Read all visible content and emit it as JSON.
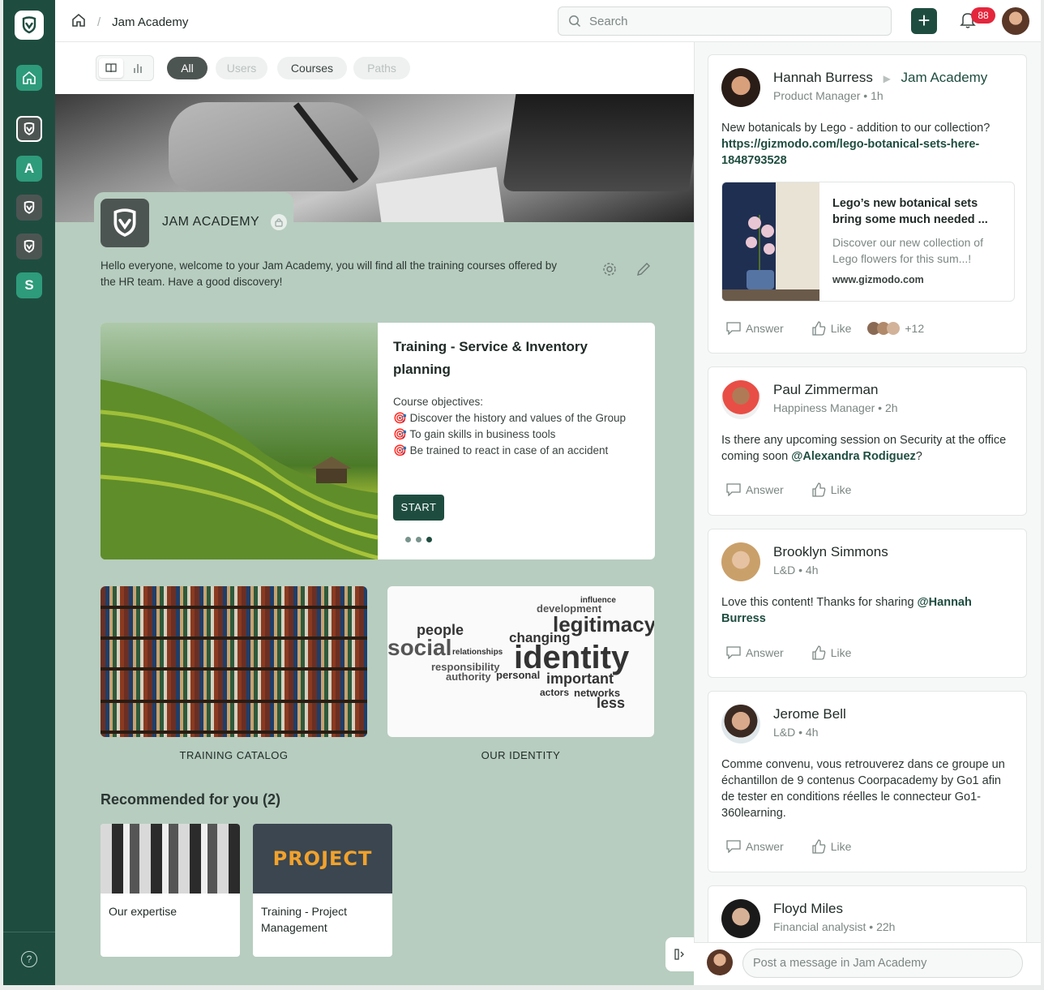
{
  "colors": {
    "brand": "#1e4d40",
    "page_bg": "#b7cdbf",
    "badge": "#e4263c"
  },
  "rail": {
    "items": [
      {
        "icon": "home-icon"
      },
      {
        "icon": "jam-logo-icon"
      },
      {
        "letter": "A"
      },
      {
        "icon": "jam-logo-icon"
      },
      {
        "icon": "jam-logo-icon"
      },
      {
        "letter": "S"
      }
    ],
    "help_label": "?"
  },
  "topbar": {
    "crumb": "Jam Academy",
    "search_placeholder": "Search",
    "plus_label": "+",
    "notifications_count": "88"
  },
  "filters": {
    "all": "All",
    "users": "Users",
    "courses": "Courses",
    "paths": "Paths"
  },
  "space": {
    "name": "JAM ACADEMY",
    "description": "Hello everyone, welcome to your Jam Academy, you will find all the training courses offered by the HR team. Have a good discovery!"
  },
  "featured": {
    "title": "Training - Service & Inventory planning",
    "objectives_title": "Course objectives:",
    "objectives": [
      "Discover the history and values of the Group",
      "To gain skills in business tools",
      "Be trained to react in case of an accident"
    ],
    "start": "START"
  },
  "tiles": {
    "catalog": "TRAINING CATALOG",
    "identity": "OUR IDENTITY"
  },
  "cloud_words": [
    "legitimacy",
    "identity",
    "social",
    "people",
    "changing",
    "development",
    "important",
    "networks",
    "less",
    "actors",
    "authority",
    "personal",
    "responsibility",
    "relationships",
    "influence"
  ],
  "recommended": {
    "title": "Recommended for you (2)",
    "items": [
      "Our expertise",
      "Training - Project Management"
    ],
    "project_word": "PROJECT"
  },
  "feed": {
    "posts": [
      {
        "name": "Hannah Burress",
        "target": "Jam Academy",
        "role": "Product Manager • 1h",
        "text": "New botanicals by Lego - addition to our collection? ",
        "link": "https://gizmodo.com/lego-botanical-sets-here-1848793528",
        "preview_title": "Lego’s new botanical sets bring some much needed ...",
        "preview_desc": "Discover our new collection of Lego flowers for this sum...!",
        "preview_url": "www.gizmodo.com",
        "answer": "Answer",
        "like": "Like",
        "likes_more": "+12"
      },
      {
        "name": "Paul Zimmerman",
        "role": "Happiness Manager • 2h",
        "text": "Is there any upcoming session on Security at the office coming soon ",
        "mention": "@Alexandra Rodiguez",
        "suffix": "?",
        "answer": "Answer",
        "like": "Like"
      },
      {
        "name": "Brooklyn Simmons",
        "role": "L&D • 4h",
        "text": "Love this content! Thanks for sharing ",
        "mention": "@Hannah Burress",
        "answer": "Answer",
        "like": "Like"
      },
      {
        "name": "Jerome Bell",
        "role": "L&D • 4h",
        "text": "Comme convenu, vous retrouverez dans ce groupe un échantillon de 9 contenus Coorpacademy by Go1 afin de tester en conditions réelles le connecteur Go1-360learning.",
        "answer": "Answer",
        "like": "Like"
      },
      {
        "name": "Floyd Miles",
        "role": "Financial analysist • 22h"
      }
    ],
    "composer_placeholder": "Post a message in Jam Academy"
  }
}
